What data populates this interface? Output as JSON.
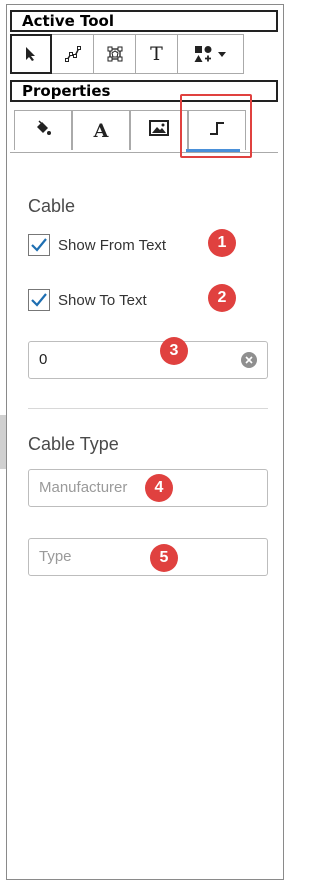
{
  "active_tool": {
    "header": "Active Tool",
    "tools": [
      {
        "icon": "pointer-icon",
        "active": true
      },
      {
        "icon": "node-edit-icon"
      },
      {
        "icon": "bounding-box-icon"
      },
      {
        "icon": "text-tool-icon",
        "glyph": "T"
      },
      {
        "icon": "shapes-dropdown-icon"
      }
    ]
  },
  "properties": {
    "header": "Properties",
    "tabs": [
      {
        "icon": "fill-bucket-icon"
      },
      {
        "icon": "text-format-icon",
        "glyph": "A"
      },
      {
        "icon": "image-icon"
      },
      {
        "icon": "cable-icon",
        "active": true
      }
    ]
  },
  "cable": {
    "heading": "Cable",
    "show_from_text": {
      "label": "Show From Text",
      "checked": true
    },
    "show_to_text": {
      "label": "Show To Text",
      "checked": true
    },
    "value_field": {
      "value": "0"
    }
  },
  "cable_type": {
    "heading": "Cable Type",
    "manufacturer": {
      "placeholder": "Manufacturer"
    },
    "type": {
      "placeholder": "Type"
    }
  },
  "badges": [
    "1",
    "2",
    "3",
    "4",
    "5"
  ],
  "colors": {
    "accent": "#4a90d9",
    "callout": "#e0413f",
    "check": "#1f6fb2"
  }
}
